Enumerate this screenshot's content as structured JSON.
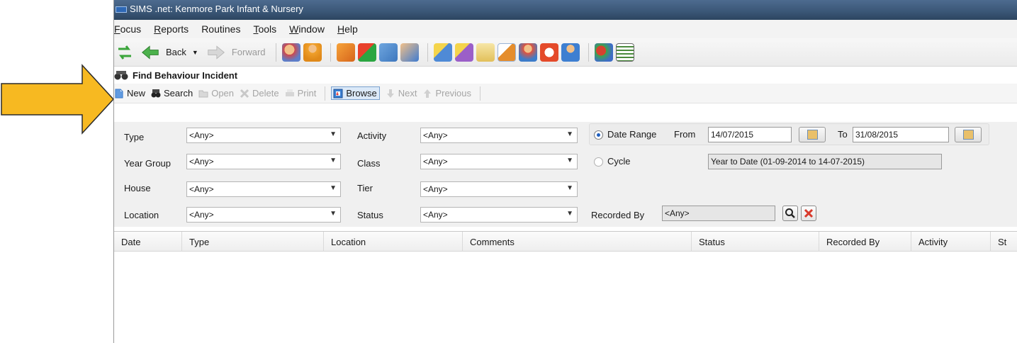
{
  "window": {
    "title": "SIMS .net: Kenmore Park Infant & Nursery"
  },
  "menu": [
    {
      "first": "F",
      "rest": "ocus"
    },
    {
      "first": "R",
      "rest": "eports"
    },
    {
      "first": "R",
      "pre": "",
      "label": "Routines"
    },
    {
      "first": "T",
      "rest": "ools"
    },
    {
      "first": "W",
      "rest": "indow"
    },
    {
      "first": "H",
      "rest": "elp"
    }
  ],
  "menu_labels": {
    "focus": "Focus",
    "reports": "Reports",
    "routines": "Routines",
    "tools": "Tools",
    "window": "Window",
    "help": "Help"
  },
  "toolbar": {
    "back_label": "Back",
    "forward_label": "Forward"
  },
  "page": {
    "title": "Find Behaviour Incident"
  },
  "actions": {
    "new": "New",
    "search": "Search",
    "open": "Open",
    "delete": "Delete",
    "print": "Print",
    "browse": "Browse",
    "next": "Next",
    "previous": "Previous"
  },
  "filters": {
    "type_label": "Type",
    "type_value": "<Any>",
    "year_group_label": "Year Group",
    "year_group_value": "<Any>",
    "house_label": "House",
    "house_value": "<Any>",
    "location_label": "Location",
    "location_value": "<Any>",
    "activity_label": "Activity",
    "activity_value": "<Any>",
    "class_label": "Class",
    "class_value": "<Any>",
    "tier_label": "Tier",
    "tier_value": "<Any>",
    "status_label": "Status",
    "status_value": "<Any>",
    "date_range_label": "Date Range",
    "from_label": "From",
    "from_value": "14/07/2015",
    "to_label": "To",
    "to_value": "31/08/2015",
    "cycle_label": "Cycle",
    "cycle_value": "Year to Date (01-09-2014 to 14-07-2015)",
    "recorded_by_label": "Recorded By",
    "recorded_by_value": "<Any>",
    "date_range_selected": true
  },
  "grid": {
    "columns": [
      "Date",
      "Type",
      "Location",
      "Comments",
      "Status",
      "Recorded By",
      "Activity",
      "St"
    ]
  },
  "colors": {
    "arrow_fill": "#f7b921",
    "title_bar": "#3a5676",
    "browse_highlight": "#dce9f8"
  }
}
